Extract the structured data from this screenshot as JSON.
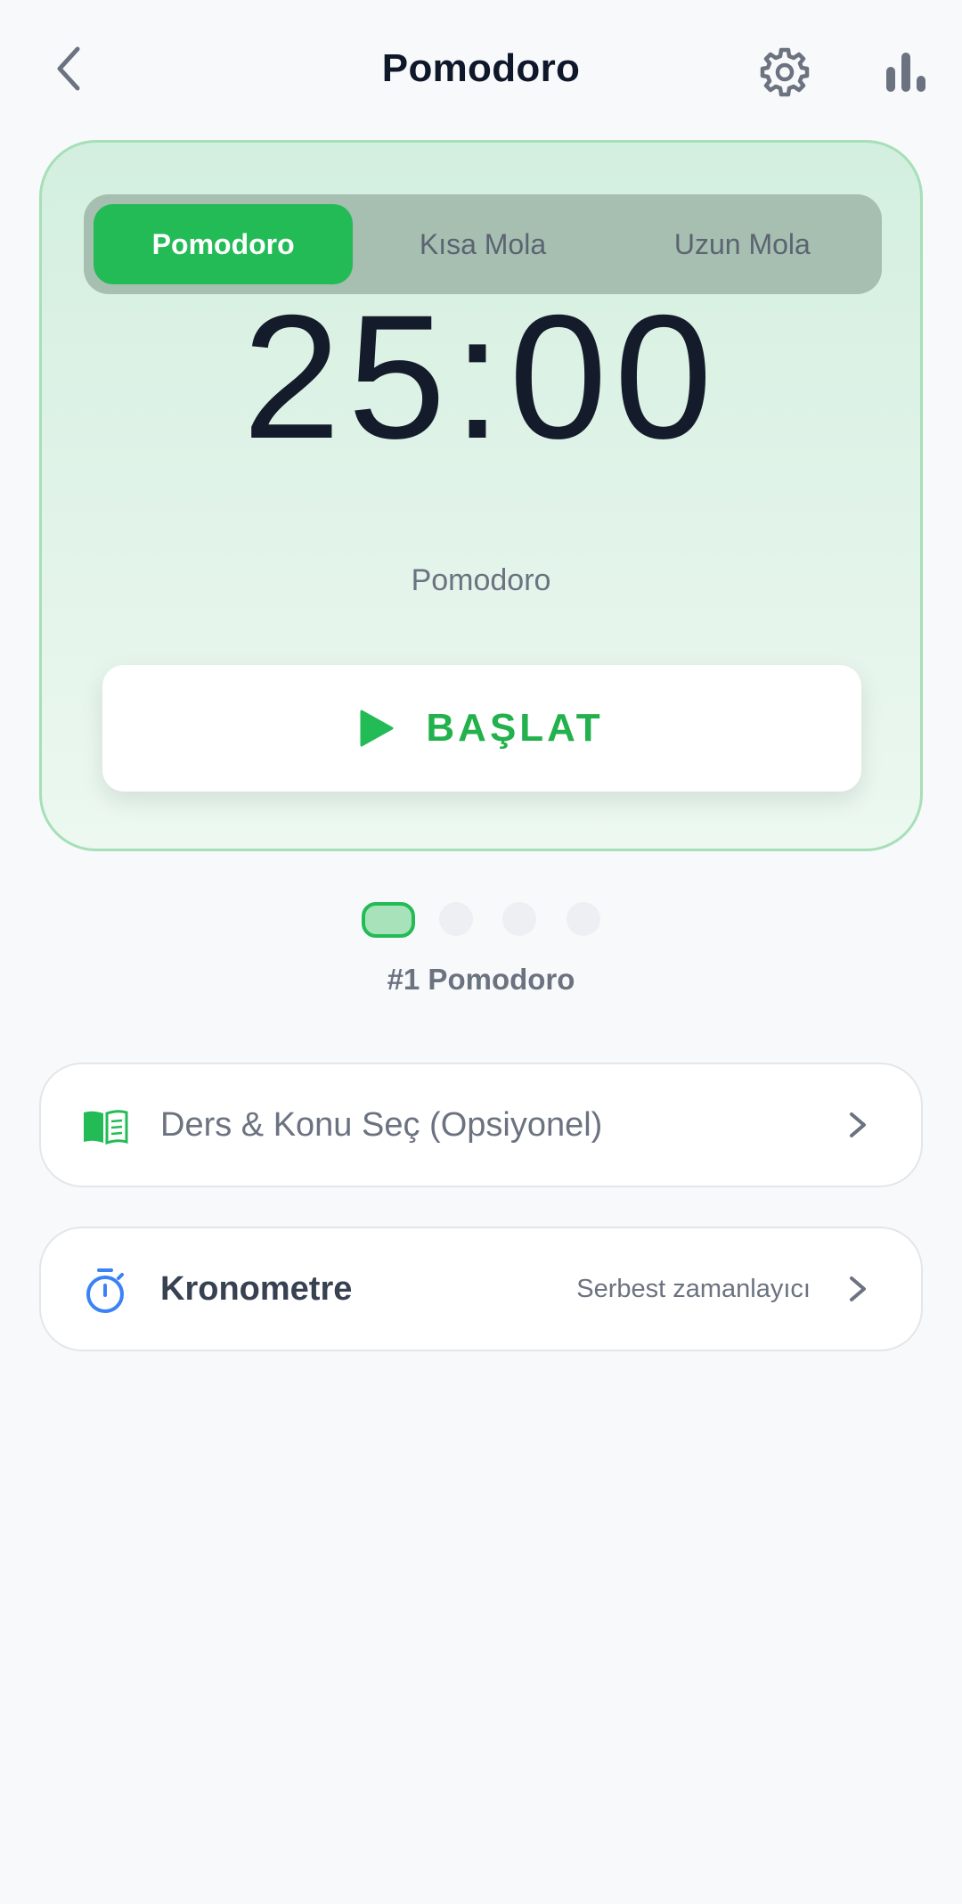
{
  "header": {
    "title": "Pomodoro",
    "back_icon": "chevron-left-icon",
    "settings_icon": "gear-icon",
    "stats_icon": "bar-chart-icon"
  },
  "timer": {
    "tabs": [
      {
        "label": "Pomodoro",
        "selected": true
      },
      {
        "label": "Kısa Mola",
        "selected": false
      },
      {
        "label": "Uzun Mola",
        "selected": false
      }
    ],
    "time": "25:00",
    "mode_caption": "Pomodoro",
    "start_label": "BAŞLAT",
    "start_icon": "play-icon"
  },
  "progress": {
    "total_dots": 4,
    "current_dot": 1,
    "session_label": "#1 Pomodoro"
  },
  "subject_row": {
    "icon": "book-icon",
    "label": "Ders & Konu Seç (Opsiyonel)"
  },
  "stopwatch_row": {
    "icon": "stopwatch-icon",
    "label": "Kronometre",
    "sublabel": "Serbest zamanlayıcı"
  },
  "colors": {
    "accent": "#22bb55",
    "card_bg": "#d9f1e3",
    "card_border": "#a6dfb8",
    "tab_track": "#a7bfb1",
    "text_dark": "#141b2b",
    "text_muted": "#6b7280",
    "stopwatch_blue": "#3b82f6"
  }
}
